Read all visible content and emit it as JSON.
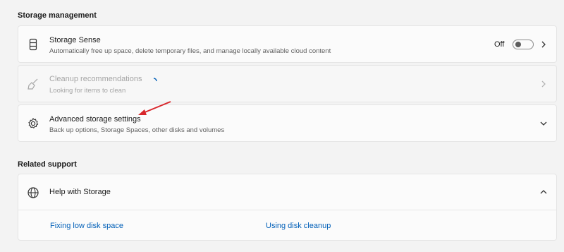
{
  "storage_management": {
    "heading": "Storage management",
    "storage_sense": {
      "title": "Storage Sense",
      "subtitle": "Automatically free up space, delete temporary files, and manage locally available cloud content",
      "toggle_label": "Off",
      "toggle_state": "off",
      "icon": "storage-drive-icon"
    },
    "cleanup": {
      "title": "Cleanup recommendations",
      "subtitle": "Looking for items to clean",
      "icon": "broom-icon",
      "disabled": true
    },
    "advanced": {
      "title": "Advanced storage settings",
      "subtitle": "Back up options, Storage Spaces, other disks and volumes",
      "icon": "gear-icon"
    }
  },
  "related_support": {
    "heading": "Related support",
    "help": {
      "title": "Help with Storage",
      "icon": "globe-icon",
      "expanded": true,
      "links": [
        "Fixing low disk space",
        "Using disk cleanup"
      ]
    }
  },
  "colors": {
    "accent": "#005fb8",
    "annotation_arrow": "#d8262b",
    "background": "#f3f3f3",
    "card": "#fbfbfb"
  }
}
